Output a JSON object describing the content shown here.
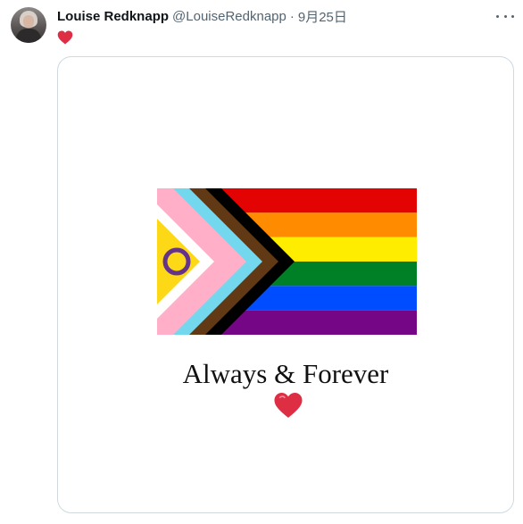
{
  "tweet": {
    "display_name": "Louise Redknapp",
    "handle": "@LouiseRedknapp",
    "separator": "·",
    "date": "9月25日",
    "text_emoji": "heart-emoji"
  },
  "media": {
    "caption": "Always & Forever",
    "caption_emoji": "heart-emoji",
    "flag_name": "intersex-inclusive-progress-pride-flag"
  },
  "colors": {
    "heart": "#e0245e",
    "border": "#cfd9de",
    "muted_text": "#536471",
    "primary_text": "#0f1419",
    "flag_red": "#e40303",
    "flag_orange": "#ff8c00",
    "flag_yellow": "#ffed00",
    "flag_green": "#008026",
    "flag_blue": "#004dff",
    "flag_purple": "#750787",
    "flag_black": "#000000",
    "flag_brown": "#613915",
    "flag_lightblue": "#73d7ee",
    "flag_pink": "#ffafc7",
    "flag_white": "#ffffff",
    "flag_intersex_yellow": "#fdd817",
    "flag_intersex_purple": "#66338b"
  }
}
